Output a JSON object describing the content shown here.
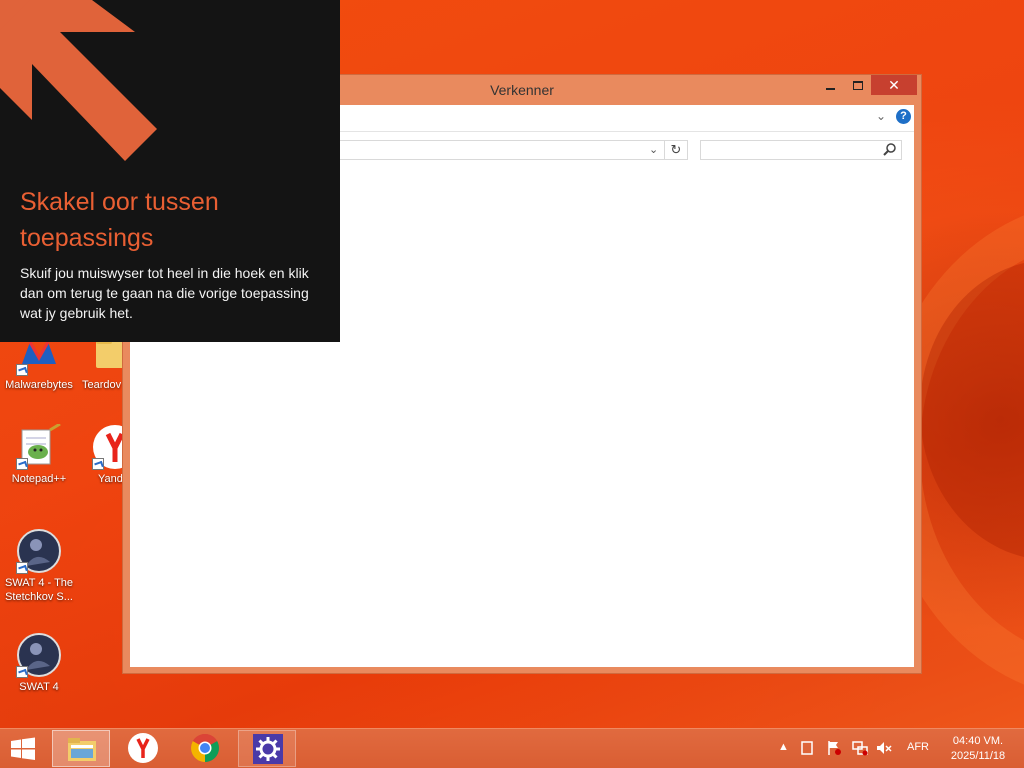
{
  "window": {
    "title": "Verkenner",
    "close_symbol": "✕"
  },
  "overlay": {
    "heading": "Skakel oor tussen toepassings",
    "body": "Skuif jou muiswyser tot heel in die hoek en klik dan om terug te gaan na die vorige toepassing wat jy gebruik het."
  },
  "desktop_icons": [
    {
      "label": "Malwarebytes",
      "icon": "malwarebytes-icon"
    },
    {
      "label": "Teardov",
      "icon": "folder-icon"
    },
    {
      "label": "Notepad++",
      "icon": "notepadpp-icon"
    },
    {
      "label": "Yand",
      "icon": "yandex-icon"
    },
    {
      "label": "SWAT 4 - The Stetchkov S...",
      "icon": "swat4-icon"
    },
    {
      "label": "SWAT 4",
      "icon": "swat4-icon"
    }
  ],
  "taskbar": {
    "apps": [
      {
        "name": "File Explorer",
        "icon": "file-explorer-icon",
        "active": true
      },
      {
        "name": "Yandex Browser",
        "icon": "yandex-browser-icon",
        "active": false
      },
      {
        "name": "Google Chrome",
        "icon": "chrome-icon",
        "active": false
      },
      {
        "name": "Settings",
        "icon": "settings-gear-icon",
        "active": false
      }
    ],
    "language": "AFR",
    "time": "04:40 VM.",
    "date": "2025/11/18"
  },
  "colors": {
    "accent_orange": "#e95f33",
    "window_frame": "#e98a5e",
    "close_red": "#c7402f",
    "taskbar": "#dc6236",
    "tip_background": "#141414"
  }
}
